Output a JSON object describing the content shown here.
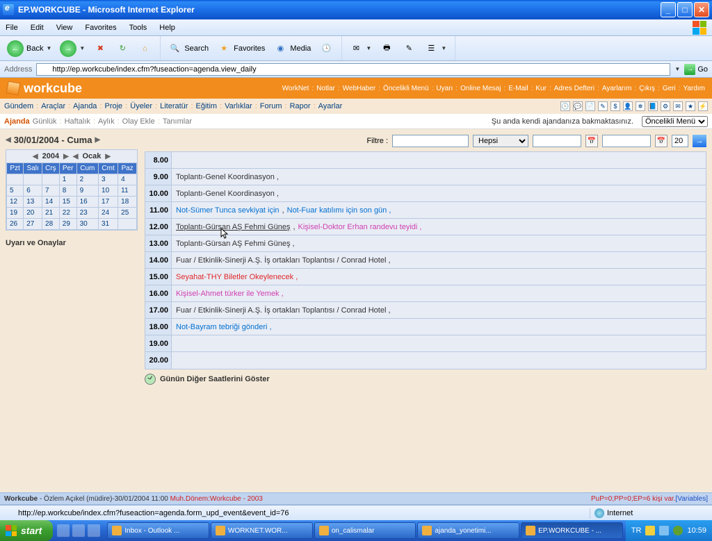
{
  "titlebar": {
    "text": "EP.WORKCUBE - Microsoft Internet Explorer"
  },
  "menubar": {
    "items": [
      "File",
      "Edit",
      "View",
      "Favorites",
      "Tools",
      "Help"
    ]
  },
  "toolbar": {
    "back": "Back",
    "search": "Search",
    "favorites": "Favorites",
    "media": "Media"
  },
  "addressbar": {
    "label": "Address",
    "url": "http://ep.workcube/index.cfm?fuseaction=agenda.view_daily",
    "go": "Go"
  },
  "app": {
    "logo": "workcube",
    "toplinks": [
      "WorkNet",
      "Notlar",
      "WebHaber",
      "Öncelikli Menü",
      "Uyarı",
      "Online Mesaj",
      "E-Mail",
      "Kur",
      "Adres Defteri",
      "Ayarlarım",
      "Çıkış",
      "Geri",
      "Yardım"
    ],
    "nav": [
      "Gündem",
      "Araçlar",
      "Ajanda",
      "Proje",
      "Üyeler",
      "Literatür",
      "Eğitim",
      "Varlıklar",
      "Forum",
      "Rapor",
      "Ayarlar"
    ],
    "subnav": {
      "title": "Ajanda",
      "items": [
        "Günlük",
        "Haftalık",
        "Aylık",
        "Olay Ekle",
        "Tanımlar"
      ],
      "status": "Şu anda kendi ajandanıza bakmaktasınız.",
      "priority_menu": "Öncelikli Menü"
    }
  },
  "date_title": "30/01/2004 - Cuma",
  "filter": {
    "label": "Filtre :",
    "dropdown": "Hepsi",
    "num": "20"
  },
  "calendar": {
    "year": "2004",
    "month": "Ocak",
    "headers": [
      "Pzt",
      "Salı",
      "Crş",
      "Per",
      "Cum",
      "Cmt",
      "Paz"
    ],
    "weeks": [
      [
        "",
        "",
        "",
        "1",
        "2",
        "3",
        "4"
      ],
      [
        "5",
        "6",
        "7",
        "8",
        "9",
        "10",
        "11"
      ],
      [
        "12",
        "13",
        "14",
        "15",
        "16",
        "17",
        "18"
      ],
      [
        "19",
        "20",
        "21",
        "22",
        "23",
        "24",
        "25"
      ],
      [
        "26",
        "27",
        "28",
        "29",
        "30",
        "31",
        ""
      ]
    ]
  },
  "approvals": "Uyarı ve Onaylar",
  "agenda": [
    {
      "h": "8.00",
      "items": []
    },
    {
      "h": "9.00",
      "items": [
        {
          "t": "Toplantı-Genel Koordinasyon ,",
          "c": "c-black"
        }
      ]
    },
    {
      "h": "10.00",
      "items": [
        {
          "t": "Toplantı-Genel Koordinasyon ,",
          "c": "c-black"
        }
      ]
    },
    {
      "h": "11.00",
      "items": [
        {
          "t": "Not-Sümer Tunca sevkiyat için",
          "c": "c-blue"
        },
        {
          "t": ",",
          "c": "c-black"
        },
        {
          "t": "Not-Fuar katılımı için son gün ,",
          "c": "c-blue"
        }
      ]
    },
    {
      "h": "12.00",
      "items": [
        {
          "t": "Toplantı-Gürsan AŞ Fehmi Güneş",
          "c": "c-black link-u"
        },
        {
          "t": ",",
          "c": "c-black"
        },
        {
          "t": "Kişisel-Doktor Erhan randevu teyidi ,",
          "c": "c-pink"
        }
      ]
    },
    {
      "h": "13.00",
      "items": [
        {
          "t": "Toplantı-Gürsan AŞ Fehmi Güneş ,",
          "c": "c-black"
        }
      ]
    },
    {
      "h": "14.00",
      "items": [
        {
          "t": "Fuar / Etkinlik-Sinerji A.Ş. İş ortakları Toplantısı / Conrad Hotel ,",
          "c": "c-black"
        }
      ]
    },
    {
      "h": "15.00",
      "items": [
        {
          "t": "Seyahat-THY Biletler Okeylenecek ,",
          "c": "c-red"
        }
      ]
    },
    {
      "h": "16.00",
      "items": [
        {
          "t": "Kişisel-Ahmet türker ile Yemek ,",
          "c": "c-pink"
        }
      ]
    },
    {
      "h": "17.00",
      "items": [
        {
          "t": "Fuar / Etkinlik-Sinerji A.Ş. İş ortakları Toplantısı / Conrad Hotel ,",
          "c": "c-black"
        }
      ]
    },
    {
      "h": "18.00",
      "items": [
        {
          "t": "Not-Bayram tebriği gönderi ,",
          "c": "c-blue"
        }
      ]
    },
    {
      "h": "19.00",
      "items": []
    },
    {
      "h": "20.00",
      "items": []
    }
  ],
  "show_more": "Günün Diğer Saatlerini Göster",
  "status_blue": {
    "left_bold": "Workcube",
    "left_user": " - Özlem Açıkel (müdire)-30/01/2004 11:00 ",
    "left_red": "Muh.Dönem:Workcube - 2003",
    "right": "PuP=0;PP=0;EP=6 kişi var.",
    "right_link": "[Variables]"
  },
  "ie_status": {
    "url": "http://ep.workcube/index.cfm?fuseaction=agenda.form_upd_event&event_id=76",
    "zone": "Internet"
  },
  "taskbar": {
    "start": "start",
    "tasks": [
      "Inbox - Outlook ...",
      "WORKNET.WOR...",
      "on_calismalar",
      "ajanda_yonetimi...",
      "EP.WORKCUBE - ..."
    ],
    "lang": "TR",
    "time": "10:59"
  }
}
